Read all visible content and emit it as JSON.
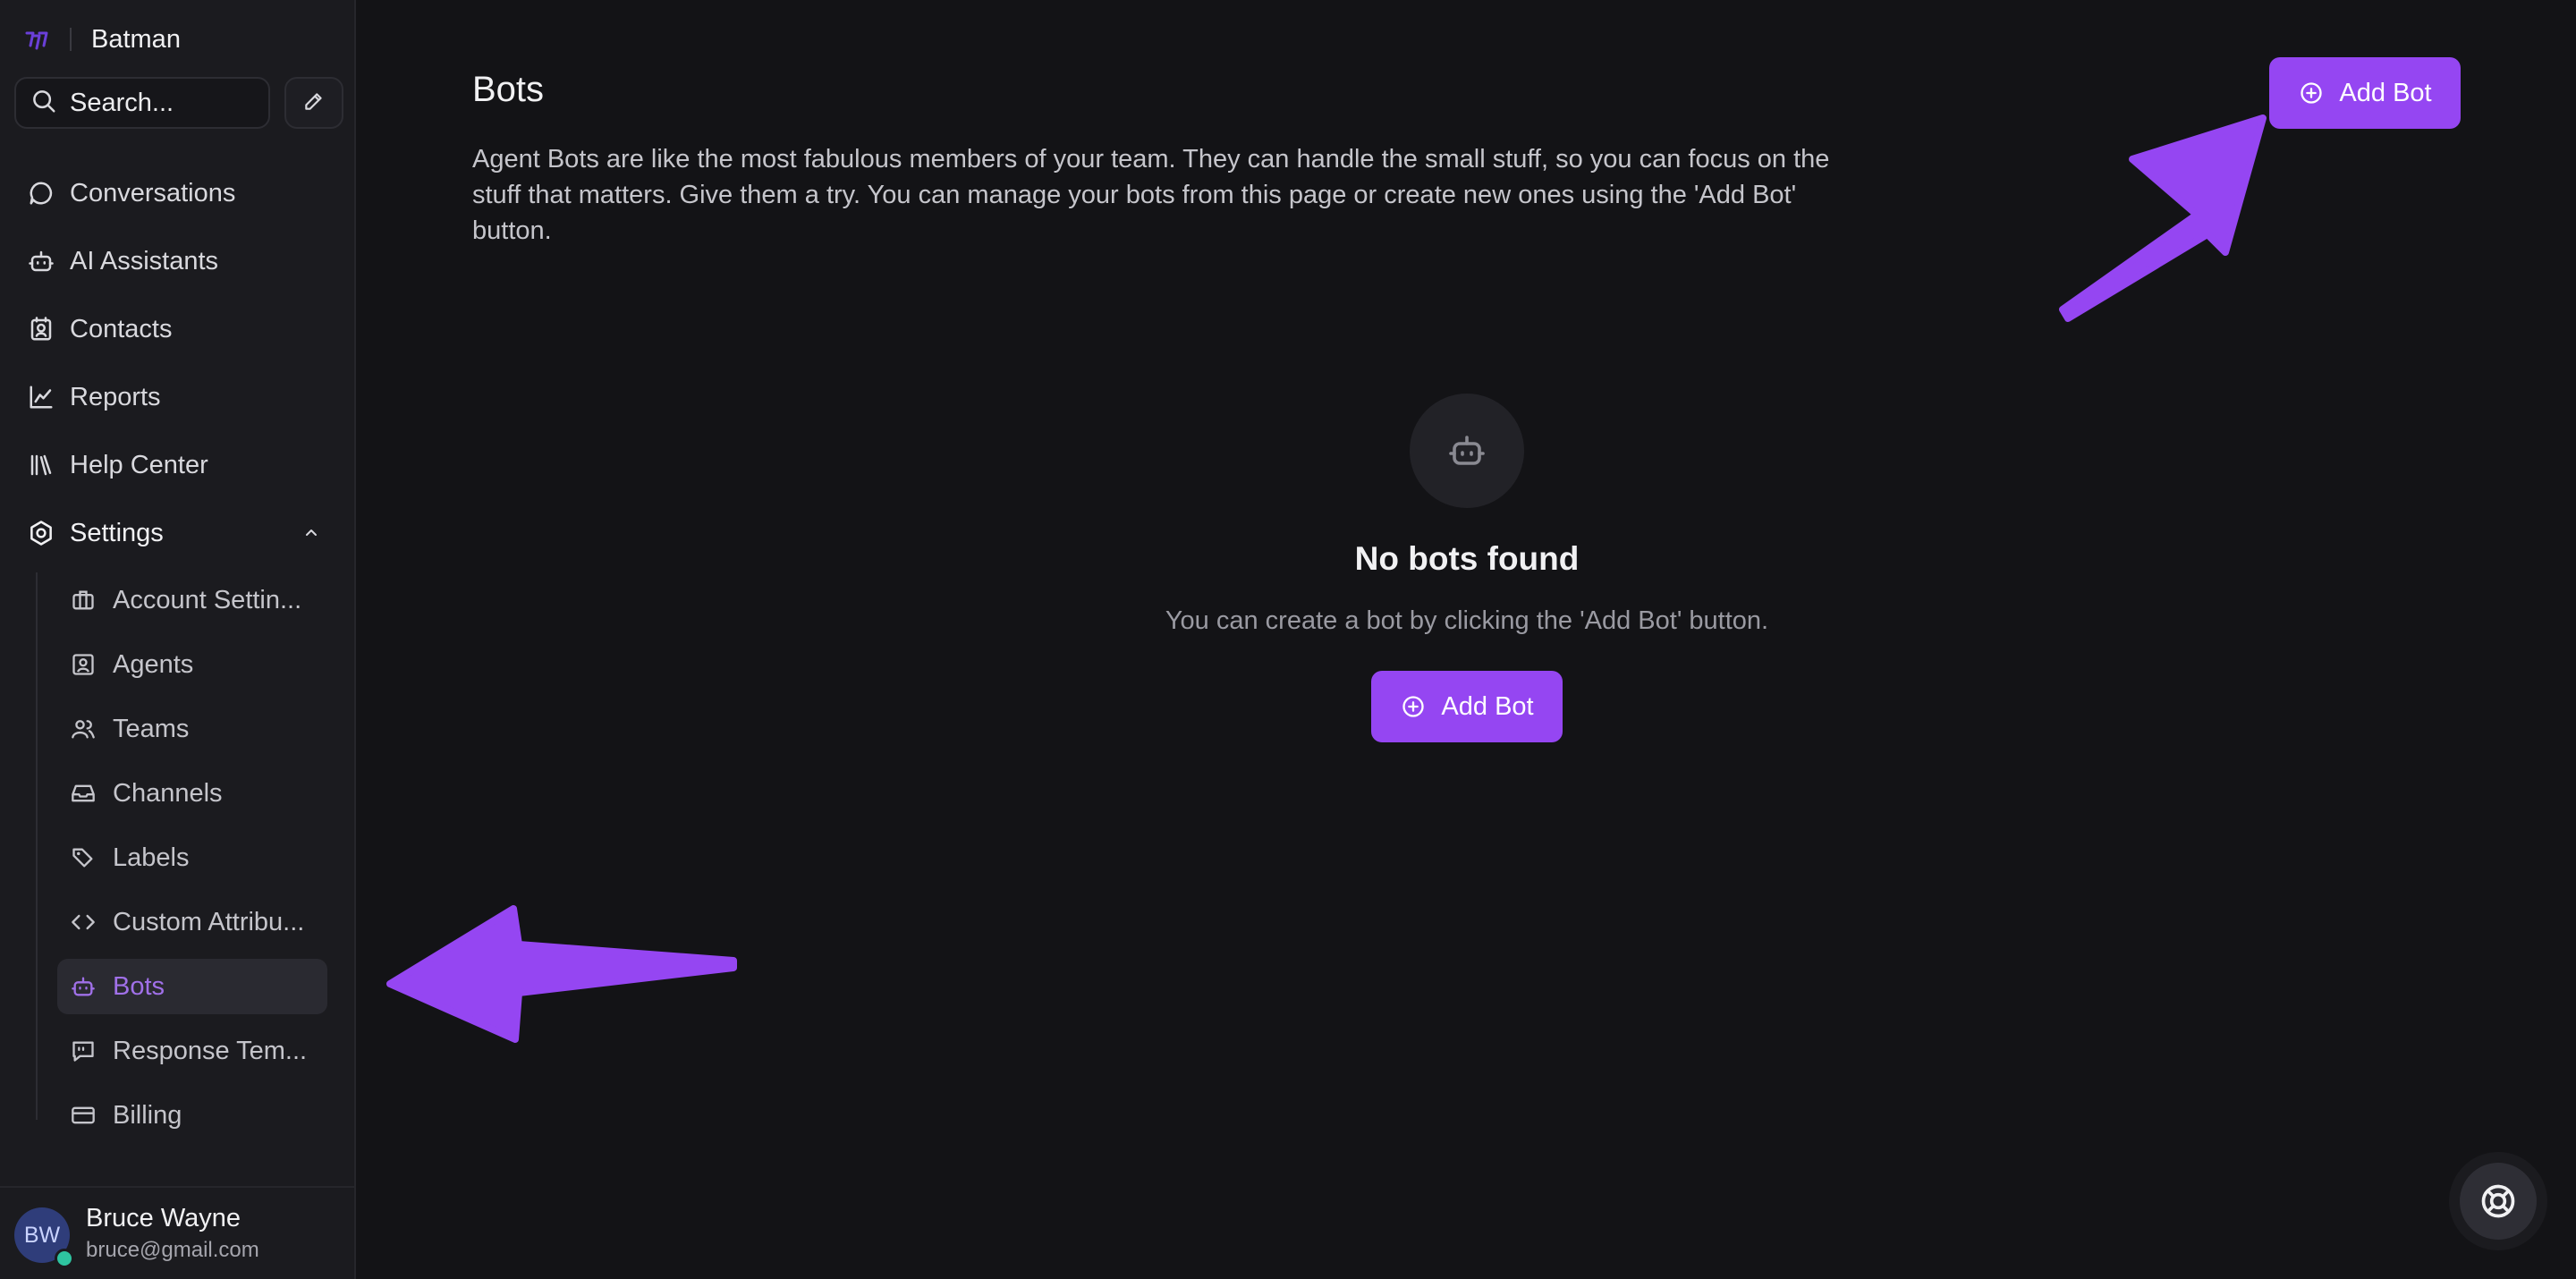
{
  "brand": {
    "name": "Batman"
  },
  "search": {
    "placeholder": "Search..."
  },
  "nav": {
    "conversations": "Conversations",
    "ai_assistants": "AI Assistants",
    "contacts": "Contacts",
    "reports": "Reports",
    "help_center": "Help Center",
    "settings": "Settings"
  },
  "settings_items": {
    "account_settings": "Account Settin...",
    "agents": "Agents",
    "teams": "Teams",
    "channels": "Channels",
    "labels": "Labels",
    "custom_attributes": "Custom Attribu...",
    "bots": "Bots",
    "response_templates": "Response Tem...",
    "billing": "Billing"
  },
  "user": {
    "initials": "BW",
    "name": "Bruce Wayne",
    "email": "bruce@gmail.com"
  },
  "main": {
    "title": "Bots",
    "description": "Agent Bots are like the most fabulous members of your team. They can handle the small stuff, so you can focus on the stuff that matters. Give them a try. You can manage your bots from this page or create new ones using the 'Add Bot' button.",
    "add_bot_label": "Add Bot",
    "empty_title": "No bots found",
    "empty_subtitle": "You can create a bot by clicking the 'Add Bot' button."
  },
  "colors": {
    "accent": "#9546f2",
    "active_text": "#a070e8",
    "background": "#131316",
    "sidebar": "#1b1b1f",
    "annotation_arrow": "#9546f2"
  }
}
